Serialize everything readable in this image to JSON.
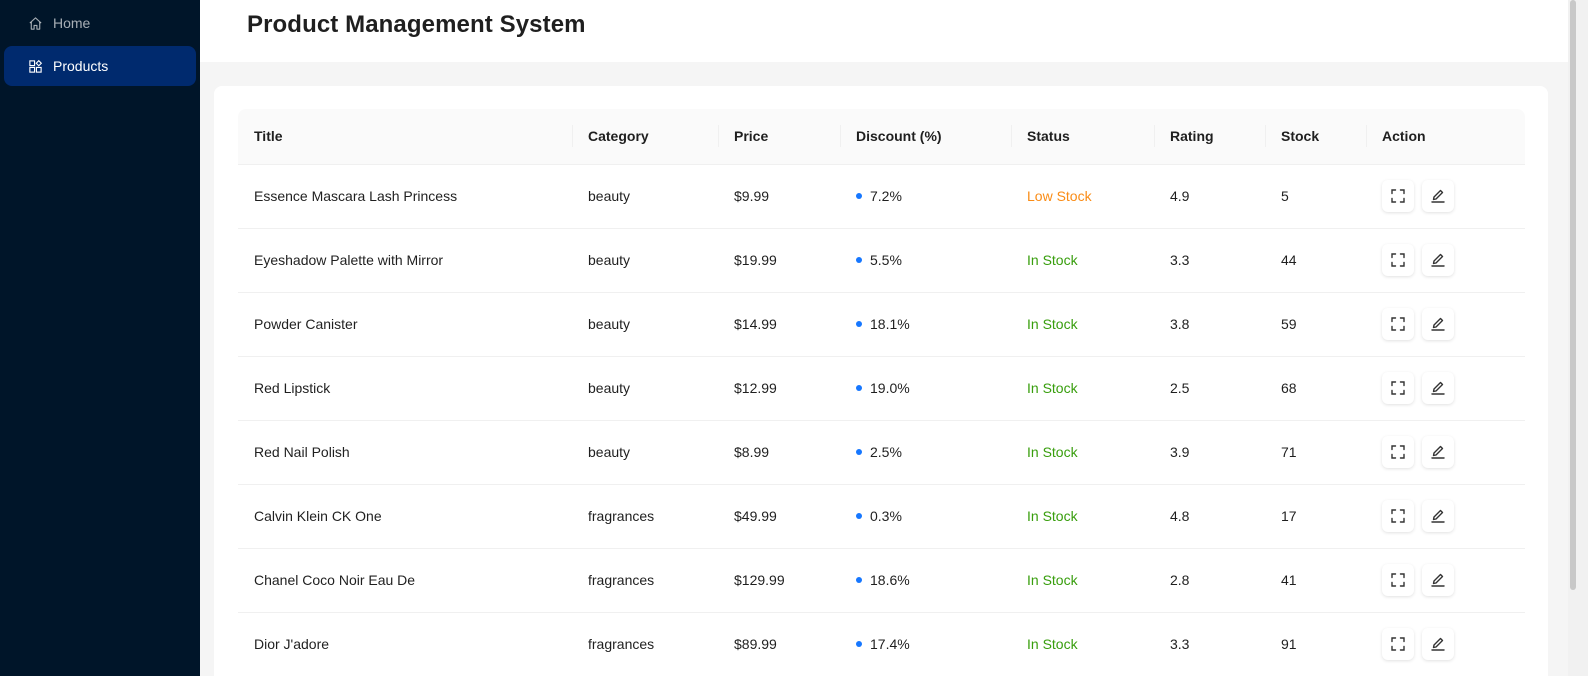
{
  "sidebar": {
    "items": [
      {
        "label": "Home",
        "icon": "home-icon"
      },
      {
        "label": "Products",
        "icon": "products-icon"
      }
    ],
    "background": "#001529",
    "active_background": "#002a6e"
  },
  "header": {
    "title": "Product Management System"
  },
  "table": {
    "columns": [
      "Title",
      "Category",
      "Price",
      "Discount (%)",
      "Status",
      "Rating",
      "Stock",
      "Action"
    ],
    "rows": [
      {
        "title": "Essence Mascara Lash Princess",
        "category": "beauty",
        "price": "$9.99",
        "discount": "7.2%",
        "status": "Low Stock",
        "rating": "4.9",
        "stock": "5"
      },
      {
        "title": "Eyeshadow Palette with Mirror",
        "category": "beauty",
        "price": "$19.99",
        "discount": "5.5%",
        "status": "In Stock",
        "rating": "3.3",
        "stock": "44"
      },
      {
        "title": "Powder Canister",
        "category": "beauty",
        "price": "$14.99",
        "discount": "18.1%",
        "status": "In Stock",
        "rating": "3.8",
        "stock": "59"
      },
      {
        "title": "Red Lipstick",
        "category": "beauty",
        "price": "$12.99",
        "discount": "19.0%",
        "status": "In Stock",
        "rating": "2.5",
        "stock": "68"
      },
      {
        "title": "Red Nail Polish",
        "category": "beauty",
        "price": "$8.99",
        "discount": "2.5%",
        "status": "In Stock",
        "rating": "3.9",
        "stock": "71"
      },
      {
        "title": "Calvin Klein CK One",
        "category": "fragrances",
        "price": "$49.99",
        "discount": "0.3%",
        "status": "In Stock",
        "rating": "4.8",
        "stock": "17"
      },
      {
        "title": "Chanel Coco Noir Eau De",
        "category": "fragrances",
        "price": "$129.99",
        "discount": "18.6%",
        "status": "In Stock",
        "rating": "2.8",
        "stock": "41"
      },
      {
        "title": "Dior J'adore",
        "category": "fragrances",
        "price": "$89.99",
        "discount": "17.4%",
        "status": "In Stock",
        "rating": "3.3",
        "stock": "91"
      }
    ],
    "action_icons": [
      "expand-icon",
      "edit-icon"
    ]
  },
  "colors": {
    "low_stock": "#fa8c16",
    "in_stock": "#389e0d",
    "discount_dot": "#1677ff"
  }
}
